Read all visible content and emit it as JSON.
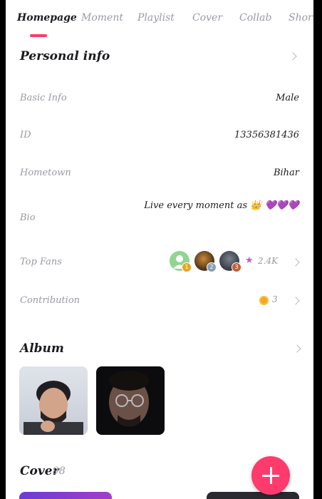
{
  "tabs": [
    {
      "label": "Homepage",
      "active": true
    },
    {
      "label": "Moment",
      "active": false
    },
    {
      "label": "Playlist",
      "active": false
    },
    {
      "label": "Cover",
      "active": false
    },
    {
      "label": "Collab",
      "active": false
    },
    {
      "label": "Short",
      "active": false
    }
  ],
  "personal_info": {
    "title": "Personal info",
    "rows": [
      {
        "label": "Basic Info",
        "value": "Male"
      },
      {
        "label": "ID",
        "value": "13356381436"
      },
      {
        "label": "Hometown",
        "value": "Bihar"
      },
      {
        "label": "Bio",
        "value": "Live every moment as 👑 💜💜💜"
      }
    ],
    "top_fans": {
      "label": "Top Fans",
      "ranks": [
        "1",
        "2",
        "3"
      ],
      "count": "2.4K"
    },
    "contribution": {
      "label": "Contribution",
      "value": "3"
    }
  },
  "album": {
    "title": "Album",
    "photo_count": 2
  },
  "cover": {
    "title": "Cover",
    "count": "98"
  },
  "colors": {
    "accent": "#ff3a6c",
    "label": "#9a9aa2",
    "text": "#1b1b1f"
  }
}
